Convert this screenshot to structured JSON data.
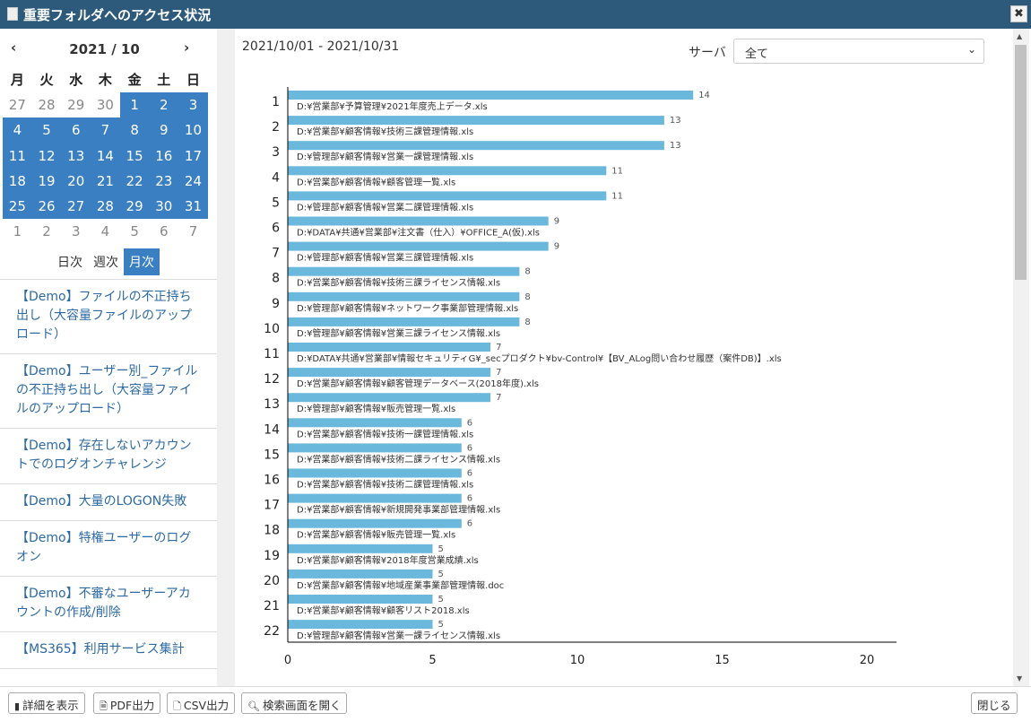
{
  "window": {
    "title": "重要フォルダへのアクセス状況",
    "close_icon": "close-icon"
  },
  "calendar": {
    "prev": "‹",
    "next": "›",
    "year_month": "2021 / 10",
    "weekdays": [
      "月",
      "火",
      "水",
      "木",
      "金",
      "土",
      "日"
    ],
    "days": [
      [
        "27",
        "28",
        "29",
        "30",
        "1",
        "2",
        "3"
      ],
      [
        "4",
        "5",
        "6",
        "7",
        "8",
        "9",
        "10"
      ],
      [
        "11",
        "12",
        "13",
        "14",
        "15",
        "16",
        "17"
      ],
      [
        "18",
        "19",
        "20",
        "21",
        "22",
        "23",
        "24"
      ],
      [
        "25",
        "26",
        "27",
        "28",
        "29",
        "30",
        "31"
      ],
      [
        "1",
        "2",
        "3",
        "4",
        "5",
        "6",
        "7"
      ]
    ]
  },
  "period": {
    "daily": "日次",
    "weekly": "週次",
    "monthly": "月次",
    "selected": "月次"
  },
  "menu": [
    "【Demo】ファイルの不正持ち出し（大容量ファイルのアップロード）",
    "【Demo】ユーザー別_ファイルの不正持ち出し（大容量ファイルのアップロード）",
    "【Demo】存在しないアカウントでのログオンチャレンジ",
    "【Demo】大量のLOGON失敗",
    "【Demo】特権ユーザーのログオン",
    "【Demo】不審なユーザーアカウントの作成/削除",
    "【MS365】利用サービス集計"
  ],
  "main": {
    "date_range": "2021/10/01 - 2021/10/31",
    "server_label": "サーバ",
    "server_value": "全て"
  },
  "chart_data": {
    "type": "bar",
    "orientation": "horizontal",
    "xlim": [
      0,
      20
    ],
    "xticks": [
      "0",
      "5",
      "10",
      "15",
      "20"
    ],
    "bar_color": "#6bb8dd",
    "categories": [
      "1",
      "2",
      "3",
      "4",
      "5",
      "6",
      "7",
      "8",
      "9",
      "10",
      "11",
      "12",
      "13",
      "14",
      "15",
      "16",
      "17",
      "18",
      "19",
      "20",
      "21",
      "22"
    ],
    "labels": [
      "D:¥営業部¥予算管理¥2021年度売上データ.xls",
      "D:¥営業部¥顧客情報¥技術三課管理情報.xls",
      "D:¥管理部¥顧客情報¥営業一課管理情報.xls",
      "D:¥営業部¥顧客情報¥顧客管理一覧.xls",
      "D:¥管理部¥顧客情報¥営業二課管理情報.xls",
      "D:¥DATA¥共通¥営業部¥注文書（仕入）¥OFFICE_A(仮).xls",
      "D:¥管理部¥顧客情報¥営業三課管理情報.xls",
      "D:¥営業部¥顧客情報¥技術三課ライセンス情報.xls",
      "D:¥管理部¥顧客情報¥ネットワーク事業部管理情報.xls",
      "D:¥管理部¥顧客情報¥営業三課ライセンス情報.xls",
      "D:¥DATA¥共通¥営業部¥情報セキュリティG¥_secプロダクト¥bv-Control¥【BV_ALog問い合わせ履歴（案件DB)】.xls",
      "D:¥営業部¥顧客情報¥顧客管理データベース(2018年度).xls",
      "D:¥管理部¥顧客情報¥販売管理一覧.xls",
      "D:¥営業部¥顧客情報¥技術一課管理情報.xls",
      "D:¥営業部¥顧客情報¥技術二課ライセンス情報.xls",
      "D:¥営業部¥顧客情報¥技術二課管理情報.xls",
      "D:¥営業部¥顧客情報¥新規開発事業部管理情報.xls",
      "D:¥営業部¥顧客情報¥販売管理一覧.xls",
      "D:¥営業部¥顧客情報¥2018年度営業成績.xls",
      "D:¥営業部¥顧客情報¥地域産業事業部管理情報.doc",
      "D:¥営業部¥顧客情報¥顧客リスト2018.xls",
      "D:¥管理部¥顧客情報¥営業一課ライセンス情報.xls"
    ],
    "values": [
      14,
      13,
      13,
      11,
      11,
      9,
      9,
      8,
      8,
      8,
      7,
      7,
      7,
      6,
      6,
      6,
      6,
      6,
      5,
      5,
      5,
      5
    ]
  },
  "footer": {
    "details": "詳細を表示",
    "pdf": "PDF出力",
    "csv": "CSV出力",
    "search": "検索画面を開く",
    "close": "閉じる"
  }
}
